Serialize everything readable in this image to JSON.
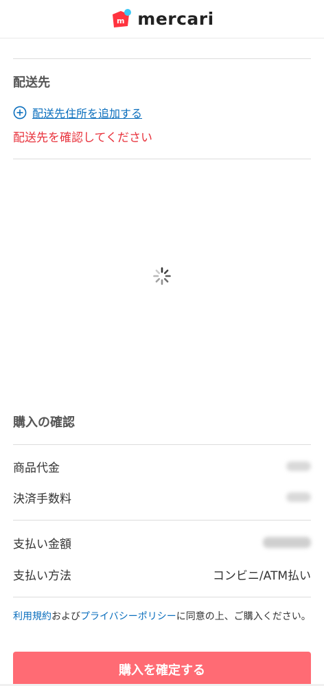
{
  "header": {
    "logo_text": "mercari",
    "logo_mark_letter": "m",
    "brand_color": "#ff333f",
    "brand_dot_color": "#3cc8f5"
  },
  "shipping": {
    "title": "配送先",
    "add_address_label": "配送先住所を追加する",
    "warning": "配送先を確認してください"
  },
  "loading": {
    "icon": "spinner-icon"
  },
  "purchase": {
    "title": "購入の確認",
    "rows": [
      {
        "label": "商品代金"
      },
      {
        "label": "決済手数料"
      },
      {
        "label": "支払い金額"
      },
      {
        "label": "支払い方法",
        "value": "コンビニ/ATM払い"
      }
    ]
  },
  "terms": {
    "link1": "利用規約",
    "text1": "および",
    "link2": "プライバシーポリシー",
    "text2": "に同意の上、ご購入ください。"
  },
  "button": {
    "label": "購入を確定する",
    "color": "#ff6b74"
  },
  "colors": {
    "link": "#0a6ebd",
    "warning": "#e8323c"
  }
}
